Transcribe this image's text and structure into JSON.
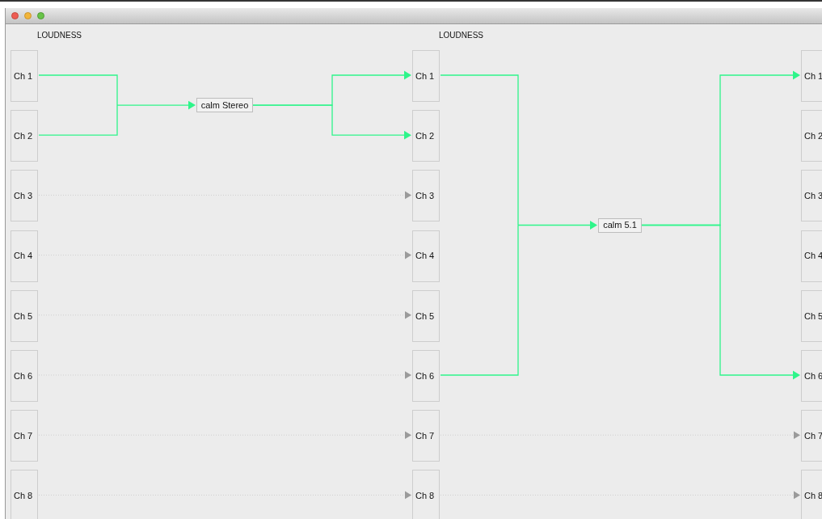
{
  "stages": [
    {
      "header": "LOUDNESS",
      "channels": [
        {
          "label": "Ch 1",
          "kind": "plain",
          "routed": true
        },
        {
          "label": "Ch 2",
          "kind": "plain",
          "routed": true
        },
        {
          "label": "Ch 3",
          "kind": "plain",
          "routed": false
        },
        {
          "label": "Ch 4",
          "kind": "plain",
          "routed": false
        },
        {
          "label": "Ch 5",
          "kind": "plain",
          "routed": false
        },
        {
          "label": "Ch 6",
          "kind": "plain",
          "routed": false
        },
        {
          "label": "Ch 7",
          "kind": "plain",
          "routed": false
        },
        {
          "label": "Ch 8",
          "kind": "plain",
          "routed": false
        }
      ]
    },
    {
      "header": "LOUDNESS",
      "channels": [
        {
          "label": "Ch 1",
          "kind": "processed",
          "routed": true
        },
        {
          "label": "Ch 2",
          "kind": "processed",
          "routed": false
        },
        {
          "label": "Ch 3",
          "kind": "passthrough",
          "routed": false
        },
        {
          "label": "Ch 4",
          "kind": "passthrough",
          "routed": false
        },
        {
          "label": "Ch 5",
          "kind": "passthrough",
          "routed": false
        },
        {
          "label": "Ch 6",
          "kind": "passthrough",
          "routed": true
        },
        {
          "label": "Ch 7",
          "kind": "passthrough",
          "routed": false
        },
        {
          "label": "Ch 8",
          "kind": "passthrough",
          "routed": false
        }
      ]
    },
    {
      "channels": [
        {
          "label": "Ch 1",
          "kind": "processed"
        },
        {
          "label": "Ch 2",
          "kind": "plain"
        },
        {
          "label": "Ch 3",
          "kind": "plain"
        },
        {
          "label": "Ch 4",
          "kind": "plain"
        },
        {
          "label": "Ch 5",
          "kind": "plain"
        },
        {
          "label": "Ch 6",
          "kind": "processed"
        },
        {
          "label": "Ch 7",
          "kind": "passthrough"
        },
        {
          "label": "Ch 8",
          "kind": "passthrough"
        }
      ]
    }
  ],
  "processors": [
    {
      "label": "calm Stereo"
    },
    {
      "label": "calm 5.1"
    }
  ]
}
